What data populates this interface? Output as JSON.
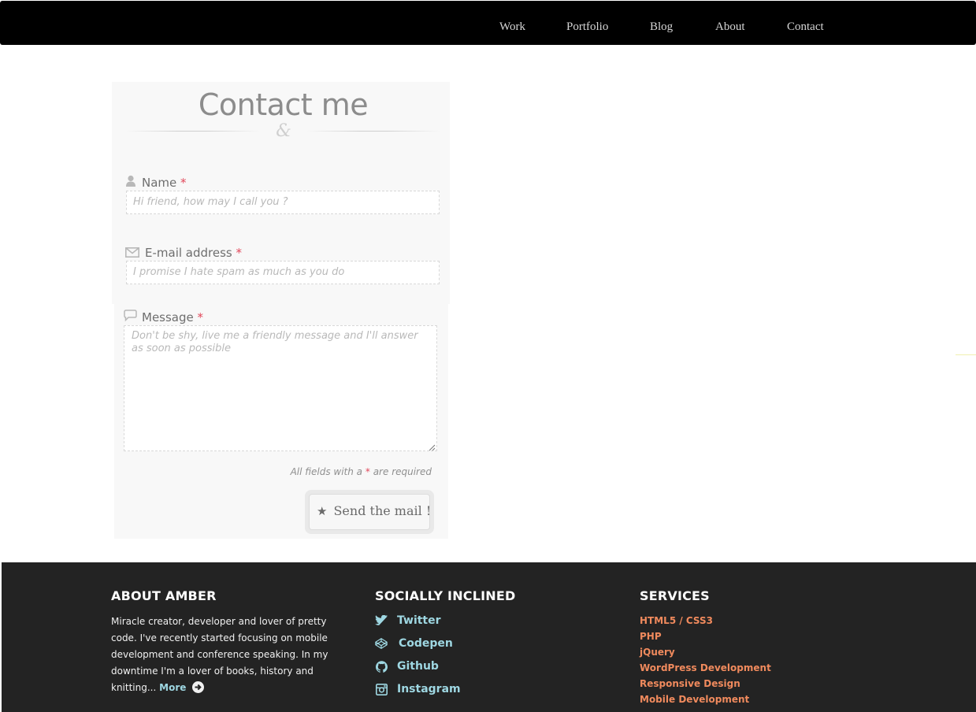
{
  "nav": {
    "items": [
      "Work",
      "Portfolio",
      "Blog",
      "About",
      "Contact"
    ]
  },
  "contact": {
    "title": "Contact me",
    "ornament": "&",
    "name_label": "Name",
    "name_placeholder": "Hi friend, how may I call you ?",
    "email_label": "E-mail address",
    "email_placeholder": "I promise I hate spam as much as you do",
    "message_label": "Message",
    "message_placeholder": "Don't be shy, live me a friendly message and I'll answer as soon as possible",
    "required_mark": "*",
    "note_before": "All fields with a",
    "note_after": "are required",
    "send_star": "★",
    "send_label": "Send the mail !"
  },
  "footer": {
    "about_heading": "ABOUT AMBER",
    "about_text": "Miracle creator, developer and lover of pretty code. I've recently started focusing on mobile development and conference speaking. In my downtime I'm a lover of books, history and knitting...",
    "more_label": "More",
    "social_heading": "SOCIALLY INCLINED",
    "social": [
      "Twitter",
      "Codepen",
      "Github",
      "Instagram"
    ],
    "services_heading": "SERVICES",
    "services": [
      "HTML5 / CSS3",
      "PHP",
      "jQuery",
      "WordPress Development",
      "Responsive Design",
      "Mobile Development"
    ]
  },
  "colors": {
    "nav_bg": "#000000",
    "panel_bg": "#f8f8f8",
    "required": "#e2475a",
    "footer_bg": "#232323",
    "link_teal": "#9ed7e2",
    "service_orange": "#f08a5d"
  },
  "icons": {
    "name": "user-icon",
    "email": "envelope-icon",
    "message": "speech-bubble-icon",
    "twitter": "twitter-icon",
    "codepen": "codepen-icon",
    "github": "github-icon",
    "instagram": "instagram-icon",
    "more": "arrow-right-circle-icon"
  }
}
